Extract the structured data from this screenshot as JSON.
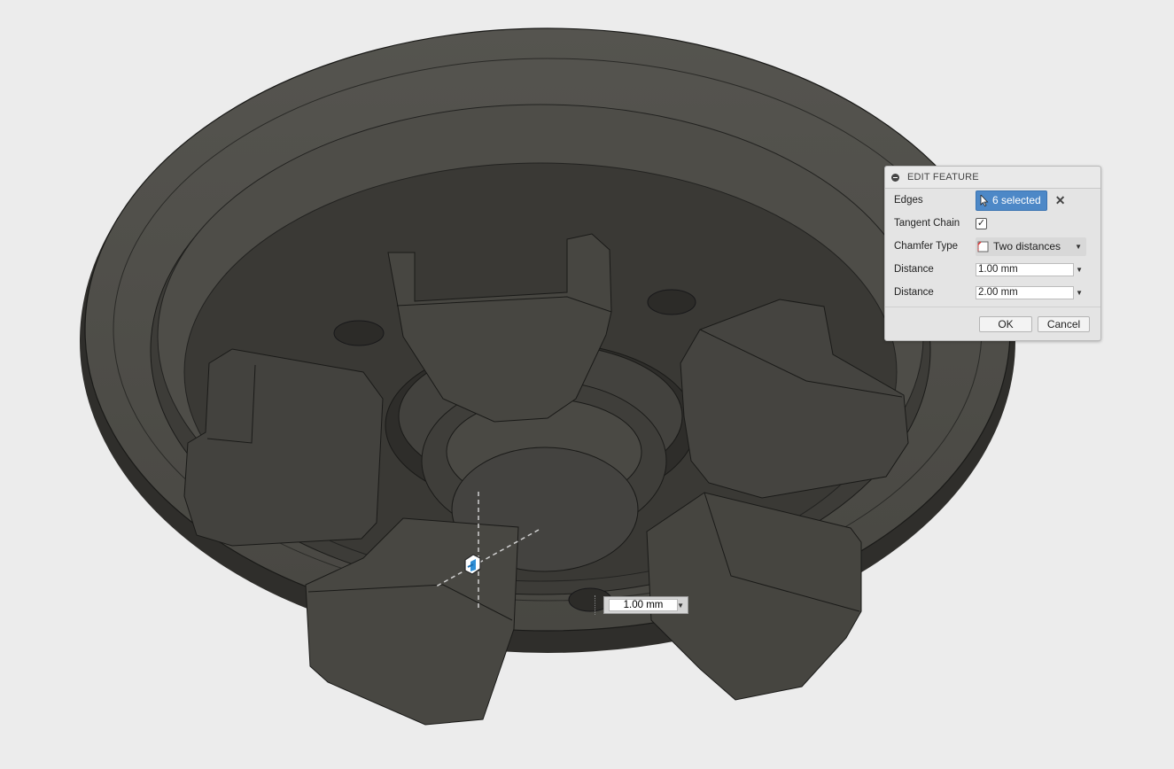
{
  "dialog": {
    "title": "EDIT FEATURE",
    "edges_label": "Edges",
    "edges_selected": "6 selected",
    "tangent_chain_label": "Tangent Chain",
    "tangent_chain_checked": true,
    "chamfer_type_label": "Chamfer Type",
    "chamfer_type_value": "Two distances",
    "distance1_label": "Distance",
    "distance1_value": "1.00 mm",
    "distance2_label": "Distance",
    "distance2_value": "2.00 mm",
    "ok_label": "OK",
    "cancel_label": "Cancel"
  },
  "canvas_input": {
    "value": "1.00 mm"
  },
  "icons": {
    "collapse": "collapse-icon",
    "cursor": "cursor-icon",
    "clear": "close-icon",
    "chamfer_type": "chamfer-type-icon",
    "dropdown": "chevron-down-icon",
    "manipulator": "chamfer-manipulator-icon"
  },
  "colors": {
    "background": "#ececec",
    "model": "#4a4944",
    "selection": "#4d88c7"
  }
}
